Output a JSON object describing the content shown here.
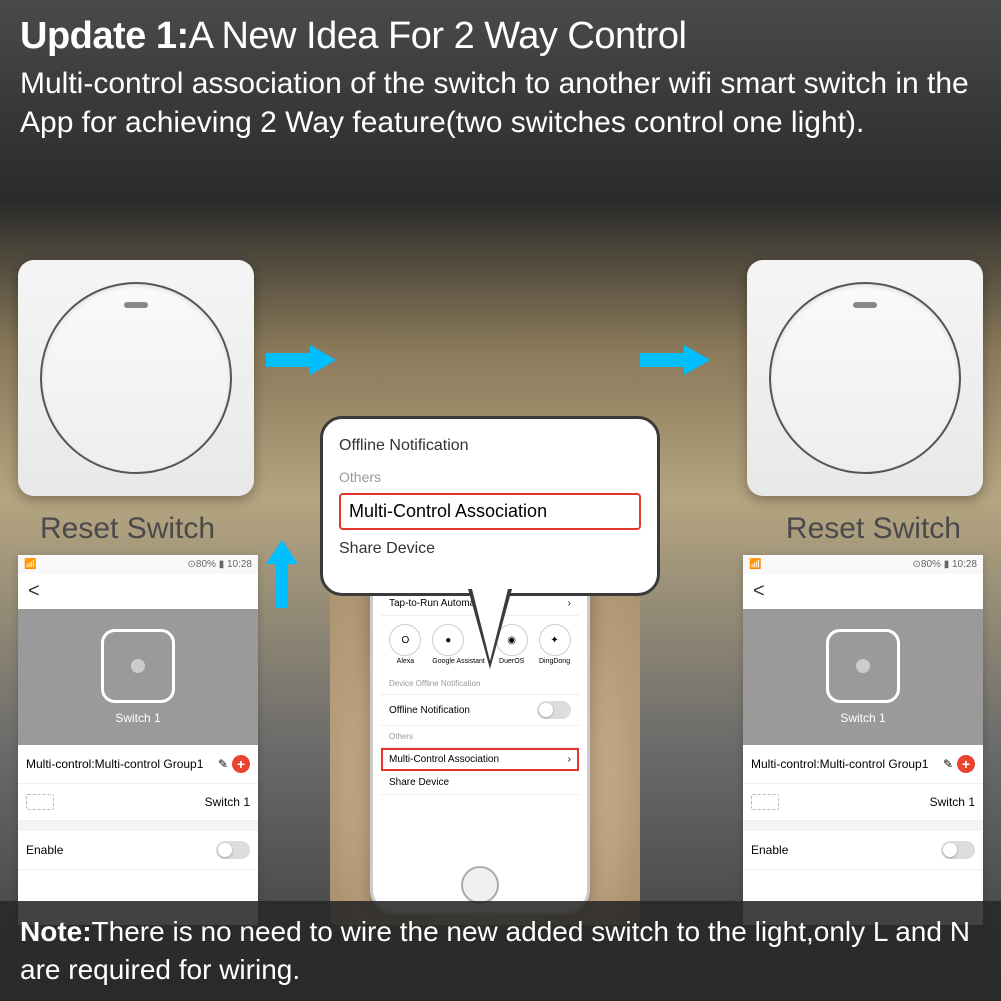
{
  "header": {
    "title_prefix": "Update 1:",
    "title_sub": "A New Idea For 2 Way Control",
    "description": "Multi-control association of the switch to another wifi smart switch in the App for achieving 2 Way feature(two switches control one light)."
  },
  "labels": {
    "reset_left": "Reset Switch",
    "reset_right": "Reset Switch"
  },
  "callout": {
    "item_top": "Offline Notification",
    "section": "Others",
    "highlighted": "Multi-Control Association",
    "item_bottom": "Share Device"
  },
  "phone": {
    "tap_run": "Tap-to-Run Automation",
    "icons": [
      {
        "label": "Alexa"
      },
      {
        "label": "Google Assistant"
      },
      {
        "label": "DuerOS"
      },
      {
        "label": "DingDong"
      }
    ],
    "section_notif": "Device Offline Notification",
    "offline": "Offline Notification",
    "others": "Others",
    "mca": "Multi-Control Association",
    "share": "Share Device"
  },
  "screenshot": {
    "status_left": "📶",
    "status_right": "⊙80% ▮ 10:28",
    "back": "<",
    "switch_label": "Switch 1",
    "multi_control": "Multi-control:Multi-control Group1",
    "switch1": "Switch 1",
    "enable": "Enable"
  },
  "note": {
    "label": "Note:",
    "text": "There is no need to wire the new added switch to the light,only L and N are required for wiring."
  }
}
